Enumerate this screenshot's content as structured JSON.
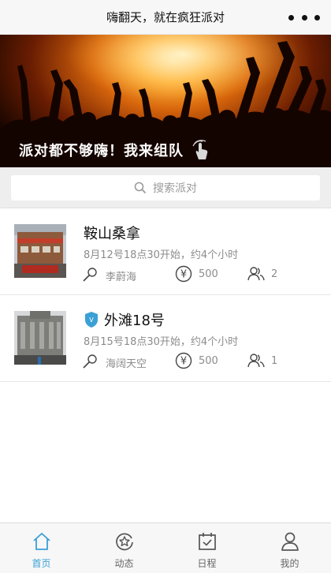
{
  "navbar": {
    "title": "嗨翻天，就在疯狂派对",
    "more_icon": "more-dots-icon"
  },
  "banner": {
    "caption": "派对都不够嗨！我来组队",
    "caption_icon": "tap-hand-icon"
  },
  "search": {
    "placeholder": "搜索派对",
    "icon": "search-icon"
  },
  "parties": [
    {
      "name": "鞍山桑拿",
      "verified": false,
      "time": "8月12号18点30开始，约4个小时",
      "host": "李蔚海",
      "price": "500",
      "people": "2"
    },
    {
      "name": "外滩18号",
      "verified": true,
      "verified_badge_text": "V",
      "time": "8月15号18点30开始，约4个小时",
      "host": "海阔天空",
      "price": "500",
      "people": "1"
    }
  ],
  "tabbar": {
    "active_color": "#3aa0d6",
    "items": [
      {
        "label": "首页",
        "icon": "home-icon",
        "active": true
      },
      {
        "label": "动态",
        "icon": "star-badge-icon",
        "active": false
      },
      {
        "label": "日程",
        "icon": "calendar-icon",
        "active": false
      },
      {
        "label": "我的",
        "icon": "user-icon",
        "active": false
      }
    ]
  }
}
